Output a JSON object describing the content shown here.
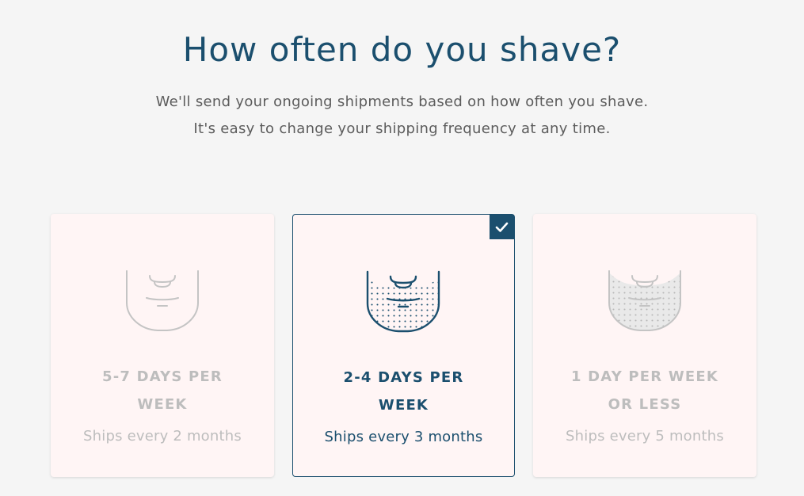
{
  "header": {
    "title": "How often do you shave?",
    "subtitle_line1": "We'll send your ongoing shipments based on how often you shave.",
    "subtitle_line2": "It's easy to change your shipping frequency at any time."
  },
  "options": [
    {
      "freq_line1": "5-7 DAYS PER",
      "freq_line2": "WEEK",
      "ships": "Ships every 2 months",
      "icon": "clean-shaven-face-icon",
      "selected": false
    },
    {
      "freq_line1": "2-4 DAYS PER",
      "freq_line2": "WEEK",
      "ships": "Ships every 3 months",
      "icon": "stubble-face-icon",
      "selected": true
    },
    {
      "freq_line1": "1 DAY PER WEEK",
      "freq_line2": "OR LESS",
      "ships": "Ships every 5 months",
      "icon": "full-beard-face-icon",
      "selected": false
    }
  ],
  "colors": {
    "accent": "#1b4f6e",
    "card_bg": "#fff5f5",
    "page_bg": "#f5f5f5",
    "muted_text": "#bdbdbd",
    "body_text": "#5c5c5c"
  }
}
